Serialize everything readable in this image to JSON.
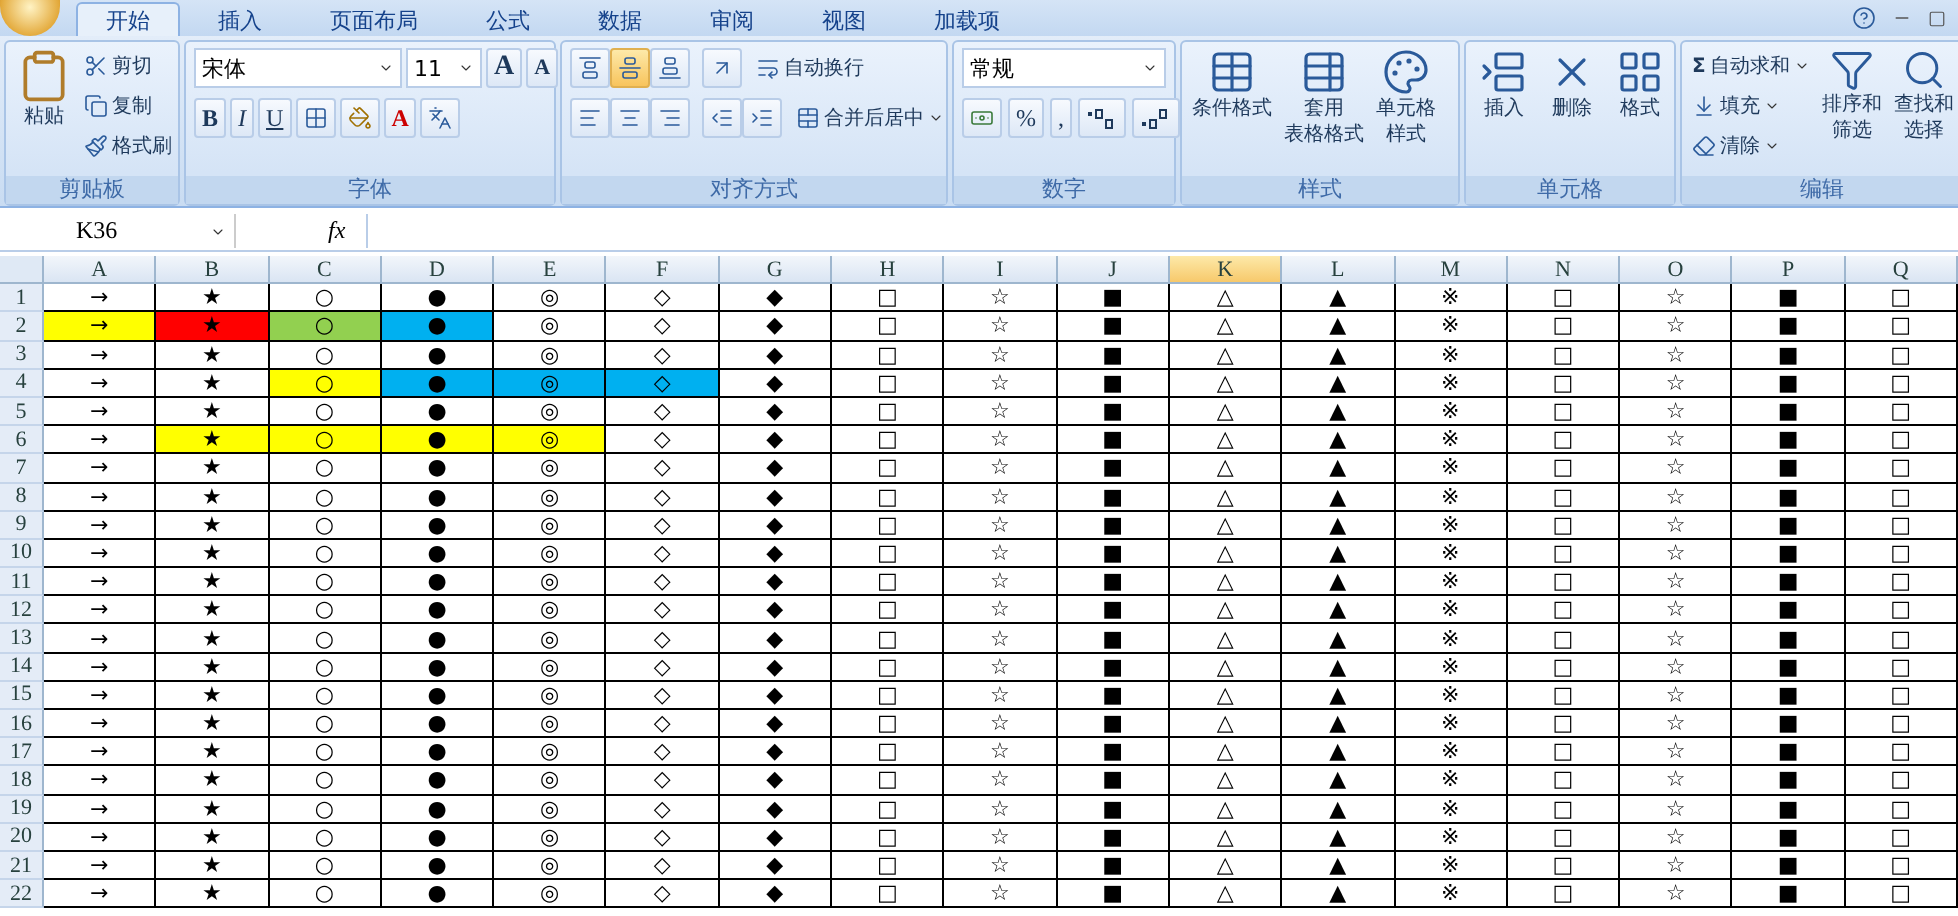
{
  "tabs": [
    {
      "label": "开始",
      "selected": true
    },
    {
      "label": "插入",
      "selected": false
    },
    {
      "label": "页面布局",
      "selected": false
    },
    {
      "label": "公式",
      "selected": false
    },
    {
      "label": "数据",
      "selected": false
    },
    {
      "label": "审阅",
      "selected": false
    },
    {
      "label": "视图",
      "selected": false
    },
    {
      "label": "加载项",
      "selected": false
    }
  ],
  "ribbon": [
    {
      "kind": "clipboard",
      "label": "剪贴板",
      "paste": "粘贴",
      "small": [
        "剪切",
        "复制",
        "格式刷"
      ]
    },
    {
      "kind": "font",
      "label": "字体",
      "font_name": "宋体",
      "font_size": "11",
      "grow_shrink": [
        "A",
        "A"
      ],
      "styles": [
        "B",
        "I",
        "U"
      ],
      "color_letter": "A"
    },
    {
      "kind": "alignment",
      "label": "对齐方式",
      "valign": [
        {
          "selected": false
        },
        {
          "selected": true
        },
        {
          "selected": false
        }
      ],
      "wrap": "自动换行",
      "merge": "合并后居中"
    },
    {
      "kind": "number",
      "label": "数字",
      "format": "常规",
      "symbols": [
        "%",
        ","
      ]
    },
    {
      "kind": "styles",
      "label": "样式",
      "buttons": [
        {
          "lines": [
            "条件格式"
          ]
        },
        {
          "lines": [
            "套用",
            "表格格式"
          ]
        },
        {
          "lines": [
            "单元格",
            "样式"
          ]
        }
      ]
    },
    {
      "kind": "cells",
      "label": "单元格",
      "buttons": [
        "插入",
        "删除",
        "格式"
      ]
    },
    {
      "kind": "editing",
      "label": "编辑",
      "sum": "Σ",
      "small": [
        "自动求和",
        "填充",
        "清除"
      ],
      "big": [
        {
          "lines": [
            "排序和",
            "筛选"
          ]
        },
        {
          "lines": [
            "查找和",
            "选择"
          ]
        }
      ]
    }
  ],
  "formula_bar": {
    "name_box": "K36",
    "fx": "fx"
  },
  "sheet": {
    "columns": [
      {
        "label": "A",
        "selected": false
      },
      {
        "label": "B",
        "selected": false
      },
      {
        "label": "C",
        "selected": false
      },
      {
        "label": "D",
        "selected": false
      },
      {
        "label": "E",
        "selected": false
      },
      {
        "label": "F",
        "selected": false
      },
      {
        "label": "G",
        "selected": false
      },
      {
        "label": "H",
        "selected": false
      },
      {
        "label": "I",
        "selected": false
      },
      {
        "label": "J",
        "selected": false
      },
      {
        "label": "K",
        "selected": true
      },
      {
        "label": "L",
        "selected": false
      },
      {
        "label": "M",
        "selected": false
      },
      {
        "label": "N",
        "selected": false
      },
      {
        "label": "O",
        "selected": false
      },
      {
        "label": "P",
        "selected": false
      },
      {
        "label": "Q",
        "selected": false
      }
    ],
    "rows": [
      {
        "number": "1",
        "cells": [
          {
            "text": "→"
          },
          {
            "text": "★"
          },
          {
            "text": "○"
          },
          {
            "text": "●"
          },
          {
            "text": "◎"
          },
          {
            "text": "◇"
          },
          {
            "text": "◆"
          },
          {
            "text": "□"
          },
          {
            "text": "☆"
          },
          {
            "text": "■"
          },
          {
            "text": "△"
          },
          {
            "text": "▲"
          },
          {
            "text": "※"
          },
          {
            "text": "□"
          },
          {
            "text": "☆"
          },
          {
            "text": "■"
          },
          {
            "text": "□"
          }
        ]
      },
      {
        "number": "2",
        "cells": [
          {
            "text": "→",
            "color": "#ffff00"
          },
          {
            "text": "★",
            "color": "#ff0000"
          },
          {
            "text": "○",
            "color": "#92d050"
          },
          {
            "text": "●",
            "color": "#00b0f0"
          },
          {
            "text": "◎"
          },
          {
            "text": "◇"
          },
          {
            "text": "◆"
          },
          {
            "text": "□"
          },
          {
            "text": "☆"
          },
          {
            "text": "■"
          },
          {
            "text": "△"
          },
          {
            "text": "▲"
          },
          {
            "text": "※"
          },
          {
            "text": "□"
          },
          {
            "text": "☆"
          },
          {
            "text": "■"
          },
          {
            "text": "□"
          }
        ]
      },
      {
        "number": "3",
        "cells": [
          {
            "text": "→"
          },
          {
            "text": "★"
          },
          {
            "text": "○"
          },
          {
            "text": "●"
          },
          {
            "text": "◎"
          },
          {
            "text": "◇"
          },
          {
            "text": "◆"
          },
          {
            "text": "□"
          },
          {
            "text": "☆"
          },
          {
            "text": "■"
          },
          {
            "text": "△"
          },
          {
            "text": "▲"
          },
          {
            "text": "※"
          },
          {
            "text": "□"
          },
          {
            "text": "☆"
          },
          {
            "text": "■"
          },
          {
            "text": "□"
          }
        ]
      },
      {
        "number": "4",
        "cells": [
          {
            "text": "→"
          },
          {
            "text": "★"
          },
          {
            "text": "○",
            "color": "#ffff00"
          },
          {
            "text": "●",
            "color": "#00b0f0"
          },
          {
            "text": "◎",
            "color": "#00b0f0"
          },
          {
            "text": "◇",
            "color": "#00b0f0"
          },
          {
            "text": "◆"
          },
          {
            "text": "□"
          },
          {
            "text": "☆"
          },
          {
            "text": "■"
          },
          {
            "text": "△"
          },
          {
            "text": "▲"
          },
          {
            "text": "※"
          },
          {
            "text": "□"
          },
          {
            "text": "☆"
          },
          {
            "text": "■"
          },
          {
            "text": "□"
          }
        ]
      },
      {
        "number": "5",
        "cells": [
          {
            "text": "→"
          },
          {
            "text": "★"
          },
          {
            "text": "○"
          },
          {
            "text": "●"
          },
          {
            "text": "◎"
          },
          {
            "text": "◇"
          },
          {
            "text": "◆"
          },
          {
            "text": "□"
          },
          {
            "text": "☆"
          },
          {
            "text": "■"
          },
          {
            "text": "△"
          },
          {
            "text": "▲"
          },
          {
            "text": "※"
          },
          {
            "text": "□"
          },
          {
            "text": "☆"
          },
          {
            "text": "■"
          },
          {
            "text": "□"
          }
        ]
      },
      {
        "number": "6",
        "cells": [
          {
            "text": "→"
          },
          {
            "text": "★",
            "color": "#ffff00"
          },
          {
            "text": "○",
            "color": "#ffff00"
          },
          {
            "text": "●",
            "color": "#ffff00"
          },
          {
            "text": "◎",
            "color": "#ffff00"
          },
          {
            "text": "◇"
          },
          {
            "text": "◆"
          },
          {
            "text": "□"
          },
          {
            "text": "☆"
          },
          {
            "text": "■"
          },
          {
            "text": "△"
          },
          {
            "text": "▲"
          },
          {
            "text": "※"
          },
          {
            "text": "□"
          },
          {
            "text": "☆"
          },
          {
            "text": "■"
          },
          {
            "text": "□"
          }
        ]
      },
      {
        "number": "7",
        "cells": [
          {
            "text": "→"
          },
          {
            "text": "★"
          },
          {
            "text": "○"
          },
          {
            "text": "●"
          },
          {
            "text": "◎"
          },
          {
            "text": "◇"
          },
          {
            "text": "◆"
          },
          {
            "text": "□"
          },
          {
            "text": "☆"
          },
          {
            "text": "■"
          },
          {
            "text": "△"
          },
          {
            "text": "▲"
          },
          {
            "text": "※"
          },
          {
            "text": "□"
          },
          {
            "text": "☆"
          },
          {
            "text": "■"
          },
          {
            "text": "□"
          }
        ]
      },
      {
        "number": "8",
        "cells": [
          {
            "text": "→"
          },
          {
            "text": "★"
          },
          {
            "text": "○"
          },
          {
            "text": "●"
          },
          {
            "text": "◎"
          },
          {
            "text": "◇"
          },
          {
            "text": "◆"
          },
          {
            "text": "□"
          },
          {
            "text": "☆"
          },
          {
            "text": "■"
          },
          {
            "text": "△"
          },
          {
            "text": "▲"
          },
          {
            "text": "※"
          },
          {
            "text": "□"
          },
          {
            "text": "☆"
          },
          {
            "text": "■"
          },
          {
            "text": "□"
          }
        ]
      },
      {
        "number": "9",
        "cells": [
          {
            "text": "→"
          },
          {
            "text": "★"
          },
          {
            "text": "○"
          },
          {
            "text": "●"
          },
          {
            "text": "◎"
          },
          {
            "text": "◇"
          },
          {
            "text": "◆"
          },
          {
            "text": "□"
          },
          {
            "text": "☆"
          },
          {
            "text": "■"
          },
          {
            "text": "△"
          },
          {
            "text": "▲"
          },
          {
            "text": "※"
          },
          {
            "text": "□"
          },
          {
            "text": "☆"
          },
          {
            "text": "■"
          },
          {
            "text": "□"
          }
        ]
      },
      {
        "number": "10",
        "cells": [
          {
            "text": "→"
          },
          {
            "text": "★"
          },
          {
            "text": "○"
          },
          {
            "text": "●"
          },
          {
            "text": "◎"
          },
          {
            "text": "◇"
          },
          {
            "text": "◆"
          },
          {
            "text": "□"
          },
          {
            "text": "☆"
          },
          {
            "text": "■"
          },
          {
            "text": "△"
          },
          {
            "text": "▲"
          },
          {
            "text": "※"
          },
          {
            "text": "□"
          },
          {
            "text": "☆"
          },
          {
            "text": "■"
          },
          {
            "text": "□"
          }
        ]
      },
      {
        "number": "11",
        "cells": [
          {
            "text": "→"
          },
          {
            "text": "★"
          },
          {
            "text": "○"
          },
          {
            "text": "●"
          },
          {
            "text": "◎"
          },
          {
            "text": "◇"
          },
          {
            "text": "◆"
          },
          {
            "text": "□"
          },
          {
            "text": "☆"
          },
          {
            "text": "■"
          },
          {
            "text": "△"
          },
          {
            "text": "▲"
          },
          {
            "text": "※"
          },
          {
            "text": "□"
          },
          {
            "text": "☆"
          },
          {
            "text": "■"
          },
          {
            "text": "□"
          }
        ]
      },
      {
        "number": "12",
        "cells": [
          {
            "text": "→"
          },
          {
            "text": "★"
          },
          {
            "text": "○"
          },
          {
            "text": "●"
          },
          {
            "text": "◎"
          },
          {
            "text": "◇"
          },
          {
            "text": "◆"
          },
          {
            "text": "□"
          },
          {
            "text": "☆"
          },
          {
            "text": "■"
          },
          {
            "text": "△"
          },
          {
            "text": "▲"
          },
          {
            "text": "※"
          },
          {
            "text": "□"
          },
          {
            "text": "☆"
          },
          {
            "text": "■"
          },
          {
            "text": "□"
          }
        ]
      },
      {
        "number": "13",
        "cells": [
          {
            "text": "→"
          },
          {
            "text": "★"
          },
          {
            "text": "○"
          },
          {
            "text": "●"
          },
          {
            "text": "◎"
          },
          {
            "text": "◇"
          },
          {
            "text": "◆"
          },
          {
            "text": "□"
          },
          {
            "text": "☆"
          },
          {
            "text": "■"
          },
          {
            "text": "△"
          },
          {
            "text": "▲"
          },
          {
            "text": "※"
          },
          {
            "text": "□"
          },
          {
            "text": "☆"
          },
          {
            "text": "■"
          },
          {
            "text": "□"
          }
        ]
      },
      {
        "number": "14",
        "cells": [
          {
            "text": "→"
          },
          {
            "text": "★"
          },
          {
            "text": "○"
          },
          {
            "text": "●"
          },
          {
            "text": "◎"
          },
          {
            "text": "◇"
          },
          {
            "text": "◆"
          },
          {
            "text": "□"
          },
          {
            "text": "☆"
          },
          {
            "text": "■"
          },
          {
            "text": "△"
          },
          {
            "text": "▲"
          },
          {
            "text": "※"
          },
          {
            "text": "□"
          },
          {
            "text": "☆"
          },
          {
            "text": "■"
          },
          {
            "text": "□"
          }
        ]
      },
      {
        "number": "15",
        "cells": [
          {
            "text": "→"
          },
          {
            "text": "★"
          },
          {
            "text": "○"
          },
          {
            "text": "●"
          },
          {
            "text": "◎"
          },
          {
            "text": "◇"
          },
          {
            "text": "◆"
          },
          {
            "text": "□"
          },
          {
            "text": "☆"
          },
          {
            "text": "■"
          },
          {
            "text": "△"
          },
          {
            "text": "▲"
          },
          {
            "text": "※"
          },
          {
            "text": "□"
          },
          {
            "text": "☆"
          },
          {
            "text": "■"
          },
          {
            "text": "□"
          }
        ]
      },
      {
        "number": "16",
        "cells": [
          {
            "text": "→"
          },
          {
            "text": "★"
          },
          {
            "text": "○"
          },
          {
            "text": "●"
          },
          {
            "text": "◎"
          },
          {
            "text": "◇"
          },
          {
            "text": "◆"
          },
          {
            "text": "□"
          },
          {
            "text": "☆"
          },
          {
            "text": "■"
          },
          {
            "text": "△"
          },
          {
            "text": "▲"
          },
          {
            "text": "※"
          },
          {
            "text": "□"
          },
          {
            "text": "☆"
          },
          {
            "text": "■"
          },
          {
            "text": "□"
          }
        ]
      },
      {
        "number": "17",
        "cells": [
          {
            "text": "→"
          },
          {
            "text": "★"
          },
          {
            "text": "○"
          },
          {
            "text": "●"
          },
          {
            "text": "◎"
          },
          {
            "text": "◇"
          },
          {
            "text": "◆"
          },
          {
            "text": "□"
          },
          {
            "text": "☆"
          },
          {
            "text": "■"
          },
          {
            "text": "△"
          },
          {
            "text": "▲"
          },
          {
            "text": "※"
          },
          {
            "text": "□"
          },
          {
            "text": "☆"
          },
          {
            "text": "■"
          },
          {
            "text": "□"
          }
        ]
      },
      {
        "number": "18",
        "cells": [
          {
            "text": "→"
          },
          {
            "text": "★"
          },
          {
            "text": "○"
          },
          {
            "text": "●"
          },
          {
            "text": "◎"
          },
          {
            "text": "◇"
          },
          {
            "text": "◆"
          },
          {
            "text": "□"
          },
          {
            "text": "☆"
          },
          {
            "text": "■"
          },
          {
            "text": "△"
          },
          {
            "text": "▲"
          },
          {
            "text": "※"
          },
          {
            "text": "□"
          },
          {
            "text": "☆"
          },
          {
            "text": "■"
          },
          {
            "text": "□"
          }
        ]
      },
      {
        "number": "19",
        "cells": [
          {
            "text": "→"
          },
          {
            "text": "★"
          },
          {
            "text": "○"
          },
          {
            "text": "●"
          },
          {
            "text": "◎"
          },
          {
            "text": "◇"
          },
          {
            "text": "◆"
          },
          {
            "text": "□"
          },
          {
            "text": "☆"
          },
          {
            "text": "■"
          },
          {
            "text": "△"
          },
          {
            "text": "▲"
          },
          {
            "text": "※"
          },
          {
            "text": "□"
          },
          {
            "text": "☆"
          },
          {
            "text": "■"
          },
          {
            "text": "□"
          }
        ]
      },
      {
        "number": "20",
        "cells": [
          {
            "text": "→"
          },
          {
            "text": "★"
          },
          {
            "text": "○"
          },
          {
            "text": "●"
          },
          {
            "text": "◎"
          },
          {
            "text": "◇"
          },
          {
            "text": "◆"
          },
          {
            "text": "□"
          },
          {
            "text": "☆"
          },
          {
            "text": "■"
          },
          {
            "text": "△"
          },
          {
            "text": "▲"
          },
          {
            "text": "※"
          },
          {
            "text": "□"
          },
          {
            "text": "☆"
          },
          {
            "text": "■"
          },
          {
            "text": "□"
          }
        ]
      },
      {
        "number": "21",
        "cells": [
          {
            "text": "→"
          },
          {
            "text": "★"
          },
          {
            "text": "○"
          },
          {
            "text": "●"
          },
          {
            "text": "◎"
          },
          {
            "text": "◇"
          },
          {
            "text": "◆"
          },
          {
            "text": "□"
          },
          {
            "text": "☆"
          },
          {
            "text": "■"
          },
          {
            "text": "△"
          },
          {
            "text": "▲"
          },
          {
            "text": "※"
          },
          {
            "text": "□"
          },
          {
            "text": "☆"
          },
          {
            "text": "■"
          },
          {
            "text": "□"
          }
        ]
      },
      {
        "number": "22",
        "cells": [
          {
            "text": "→"
          },
          {
            "text": "★"
          },
          {
            "text": "○"
          },
          {
            "text": "●"
          },
          {
            "text": "◎"
          },
          {
            "text": "◇"
          },
          {
            "text": "◆"
          },
          {
            "text": "□"
          },
          {
            "text": "☆"
          },
          {
            "text": "■"
          },
          {
            "text": "△"
          },
          {
            "text": "▲"
          },
          {
            "text": "※"
          },
          {
            "text": "□"
          },
          {
            "text": "☆"
          },
          {
            "text": "■"
          },
          {
            "text": "□"
          }
        ]
      }
    ]
  }
}
